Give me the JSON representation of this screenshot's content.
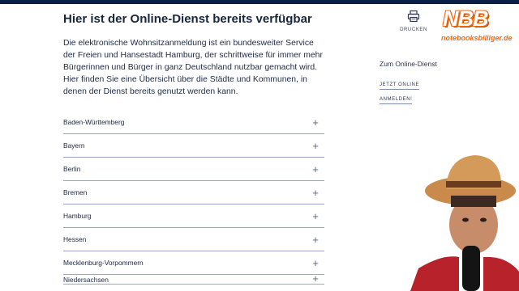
{
  "colors": {
    "topbar": "#0b1f45",
    "accordion_line": "#9aa7c8",
    "logo_orange": "#f36b12"
  },
  "main": {
    "heading": "Hier ist der Online-Dienst bereits verfügbar",
    "intro": "Die elektronische Wohnsitzanmeldung ist ein bundesweiter Service der Freien und Hansestadt Hamburg, der schrittweise für immer mehr Bürgerinnen und Bürger in ganz Deutschland nutzbar gemacht wird. Hier finden Sie eine Übersicht über die Städte und Kommunen, in denen der Dienst bereits genutzt werden kann."
  },
  "accordion": {
    "items": [
      {
        "label": "Baden-Württemberg",
        "icon": "plus-icon"
      },
      {
        "label": "Bayern",
        "icon": "plus-icon"
      },
      {
        "label": "Berlin",
        "icon": "plus-icon"
      },
      {
        "label": "Bremen",
        "icon": "plus-icon"
      },
      {
        "label": "Hamburg",
        "icon": "plus-icon"
      },
      {
        "label": "Hessen",
        "icon": "plus-icon"
      },
      {
        "label": "Mecklenburg-Vorpommern",
        "icon": "plus-icon"
      },
      {
        "label": "Niedersachsen",
        "icon": "plus-icon"
      }
    ]
  },
  "print": {
    "icon": "printer-icon",
    "label": "DRUCKEN"
  },
  "aside": {
    "title": "Zum Online-Dienst",
    "link_line1": "JETZT ONLINE",
    "link_line2": "ANMELDEN!"
  },
  "logo": {
    "brand": "NBB",
    "subtitle": "notebooksbilliger.de"
  }
}
